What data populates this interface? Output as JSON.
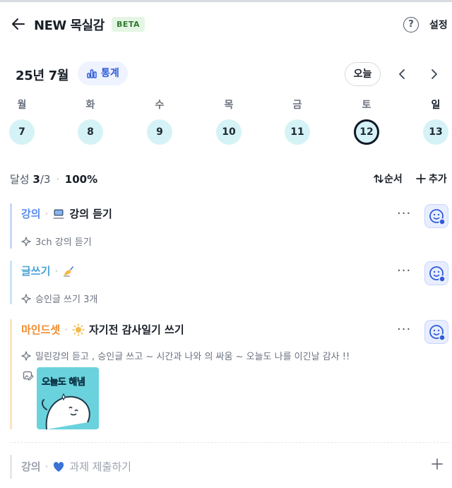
{
  "header": {
    "title": "NEW 목실감",
    "badge": "BETA",
    "help_label": "?",
    "settings_label": "설정"
  },
  "calendar": {
    "month_label": "25년 7월",
    "stats_label": "통계",
    "today_label": "오늘",
    "days": [
      {
        "dow": "월",
        "date": "7",
        "selected": false
      },
      {
        "dow": "화",
        "date": "8",
        "selected": false
      },
      {
        "dow": "수",
        "date": "9",
        "selected": false
      },
      {
        "dow": "목",
        "date": "10",
        "selected": false
      },
      {
        "dow": "금",
        "date": "11",
        "selected": false
      },
      {
        "dow": "토",
        "date": "12",
        "selected": true
      },
      {
        "dow": "일",
        "date": "13",
        "selected": false
      }
    ]
  },
  "progress": {
    "label": "달성",
    "done": "3",
    "total": "/3",
    "dot": "·",
    "percent": "100%",
    "order_label": "순서",
    "add_label": "추가"
  },
  "tasks": [
    {
      "category": "강의",
      "name": "강의 듣기",
      "emoji_icon": "laptop-icon",
      "note": "3ch 강의 듣기",
      "category_color": "#5b8def",
      "bar_color": "#c9d8f7"
    },
    {
      "category": "글쓰기",
      "name": "",
      "emoji_icon": "writing-hand-icon",
      "note": "승인글 쓰기 3개",
      "category_color": "#4aa3d8",
      "bar_color": "#c9e6f7"
    },
    {
      "category": "마인드셋",
      "name": "자기전 감사일기 쓰기",
      "emoji_icon": "sun-icon",
      "note": "밀린강의 듣고 , 승인글 쓰고 ~ 시간과 나와 의 싸움 ~ 오늘도 나를 이긴날 감사 !!",
      "category_color": "#f08c2e",
      "bar_color": "#fde3bf",
      "sticker_text": "오늘도 해냄"
    }
  ],
  "pending_task": {
    "category": "강의",
    "name": "과제 제출하기",
    "emoji_icon": "blue-heart-icon"
  },
  "colors": {
    "accent": "#2f5bd8",
    "date_bg": "#d5f3f6",
    "beta_bg": "#e4f6e3"
  }
}
